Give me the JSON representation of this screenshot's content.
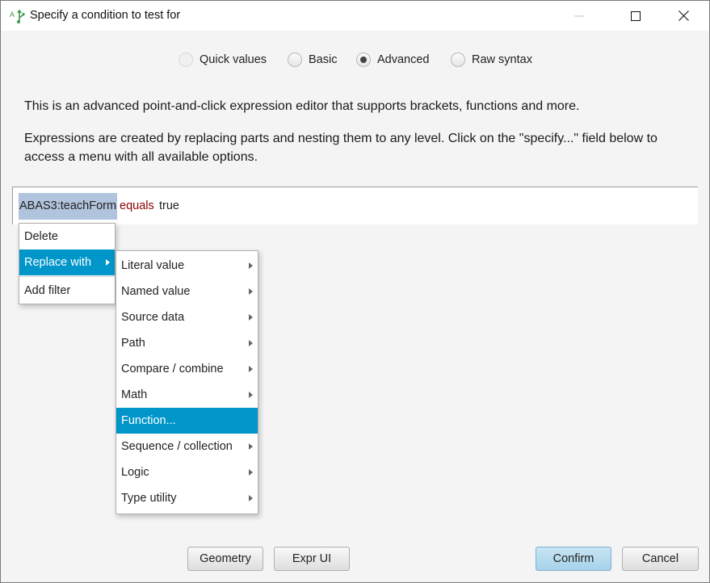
{
  "window": {
    "title": "Specify a condition to test for",
    "app_icon": "flow-branch-icon",
    "controls": {
      "minimize": "minimize-icon",
      "maximize": "maximize-icon",
      "close": "close-icon"
    }
  },
  "mode_selector": {
    "options": [
      {
        "label": "Quick values",
        "selected": false,
        "enabled": false
      },
      {
        "label": "Basic",
        "selected": false,
        "enabled": true
      },
      {
        "label": "Advanced",
        "selected": true,
        "enabled": true
      },
      {
        "label": "Raw syntax",
        "selected": false,
        "enabled": true
      }
    ]
  },
  "description": {
    "line1": "This is an advanced point-and-click expression editor that supports brackets, functions and more.",
    "line2": "Expressions are created by replacing parts and nesting them to any level. Click on the \"specify...\" field below to access a menu with all available options."
  },
  "expression": {
    "field": "ABAS3:teachForm",
    "operator": "equals",
    "value": "true",
    "colors": {
      "field_highlight": "#b1c4dd",
      "operator": "#8b0000"
    }
  },
  "context_menu": {
    "items": [
      {
        "label": "Delete",
        "submenu": false,
        "selected": false
      },
      {
        "label": "Replace with",
        "submenu": true,
        "selected": true
      },
      {
        "label": "Add filter",
        "submenu": false,
        "selected": false
      }
    ]
  },
  "replace_submenu": {
    "items": [
      {
        "label": "Literal value",
        "submenu": true,
        "selected": false
      },
      {
        "label": "Named value",
        "submenu": true,
        "selected": false
      },
      {
        "label": "Source data",
        "submenu": true,
        "selected": false
      },
      {
        "label": "Path",
        "submenu": true,
        "selected": false
      },
      {
        "label": "Compare / combine",
        "submenu": true,
        "selected": false
      },
      {
        "label": "Math",
        "submenu": true,
        "selected": false
      },
      {
        "label": "Function...",
        "submenu": false,
        "selected": true
      },
      {
        "label": "Sequence / collection",
        "submenu": true,
        "selected": false
      },
      {
        "label": "Logic",
        "submenu": true,
        "selected": false
      },
      {
        "label": "Type utility",
        "submenu": true,
        "selected": false
      }
    ]
  },
  "buttons": {
    "geometry": "Geometry",
    "expr_ui": "Expr UI",
    "confirm": "Confirm",
    "cancel": "Cancel"
  },
  "colors": {
    "selection": "#0096c9",
    "default_button": "#a6d2ea"
  }
}
